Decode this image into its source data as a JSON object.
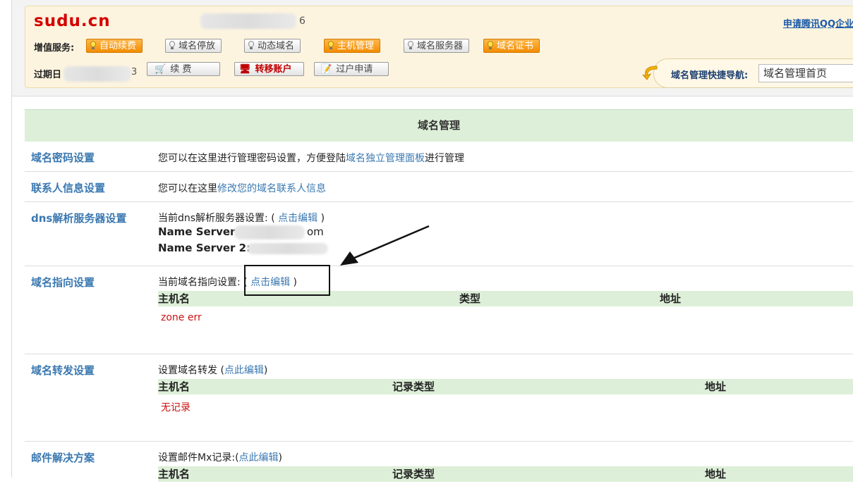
{
  "header": {
    "brand": "sudu.cn",
    "domain_tail": "6",
    "qq_link": "申请腾讯QQ企业",
    "services_label": "增值服务:",
    "services": [
      {
        "label": "自动续费",
        "style": "orange"
      },
      {
        "label": "域名停放",
        "style": "gray"
      },
      {
        "label": "动态域名",
        "style": "gray"
      },
      {
        "label": "主机管理",
        "style": "orange"
      },
      {
        "label": "域名服务器",
        "style": "gray"
      },
      {
        "label": "域名证书",
        "style": "orange"
      }
    ],
    "expiry_label": "过期日",
    "expiry_tail": "3",
    "actions": [
      {
        "label": "续 费",
        "icon": "cart-icon"
      },
      {
        "label": "转移账户",
        "icon": "transfer-icon"
      },
      {
        "label": "过户申请",
        "icon": "edit-icon"
      }
    ],
    "nav_label": "域名管理快捷导航:",
    "nav_selected": "域名管理首页"
  },
  "main": {
    "title": "域名管理",
    "rows": {
      "password": {
        "title": "域名密码设置",
        "text_before": "您可以在这里进行管理密码设置，方便登陆",
        "link": "域名独立管理面板",
        "text_after": "进行管理"
      },
      "contact": {
        "title": "联系人信息设置",
        "text_before": "您可以在这里",
        "link": "修改您的域名联系人信息"
      },
      "dns": {
        "title": "dns解析服务器设置",
        "text_before": "当前dns解析服务器设置: (",
        "link": "点击编辑",
        "text_after": ")",
        "ns1_label": "Name Server 1",
        "ns1_tail": "om",
        "ns2_label": "Name Server 2:"
      },
      "pointing": {
        "title": "域名指向设置",
        "text_before": "当前域名指向设置: (",
        "link": "点击编辑",
        "text_after": ")",
        "columns": [
          "主机名",
          "类型",
          "地址"
        ],
        "status": "zone err"
      },
      "forward": {
        "title": "域名转发设置",
        "text_before": "设置域名转发 (",
        "link": "点此编辑",
        "text_after": ")",
        "columns": [
          "主机名",
          "记录类型",
          "地址"
        ],
        "status": "无记录"
      },
      "mail": {
        "title": "邮件解决方案",
        "text_before": "设置邮件Mx记录:(",
        "link": "点此编辑",
        "text_after": ")",
        "columns": [
          "主机名",
          "记录类型",
          "地址"
        ]
      }
    }
  }
}
